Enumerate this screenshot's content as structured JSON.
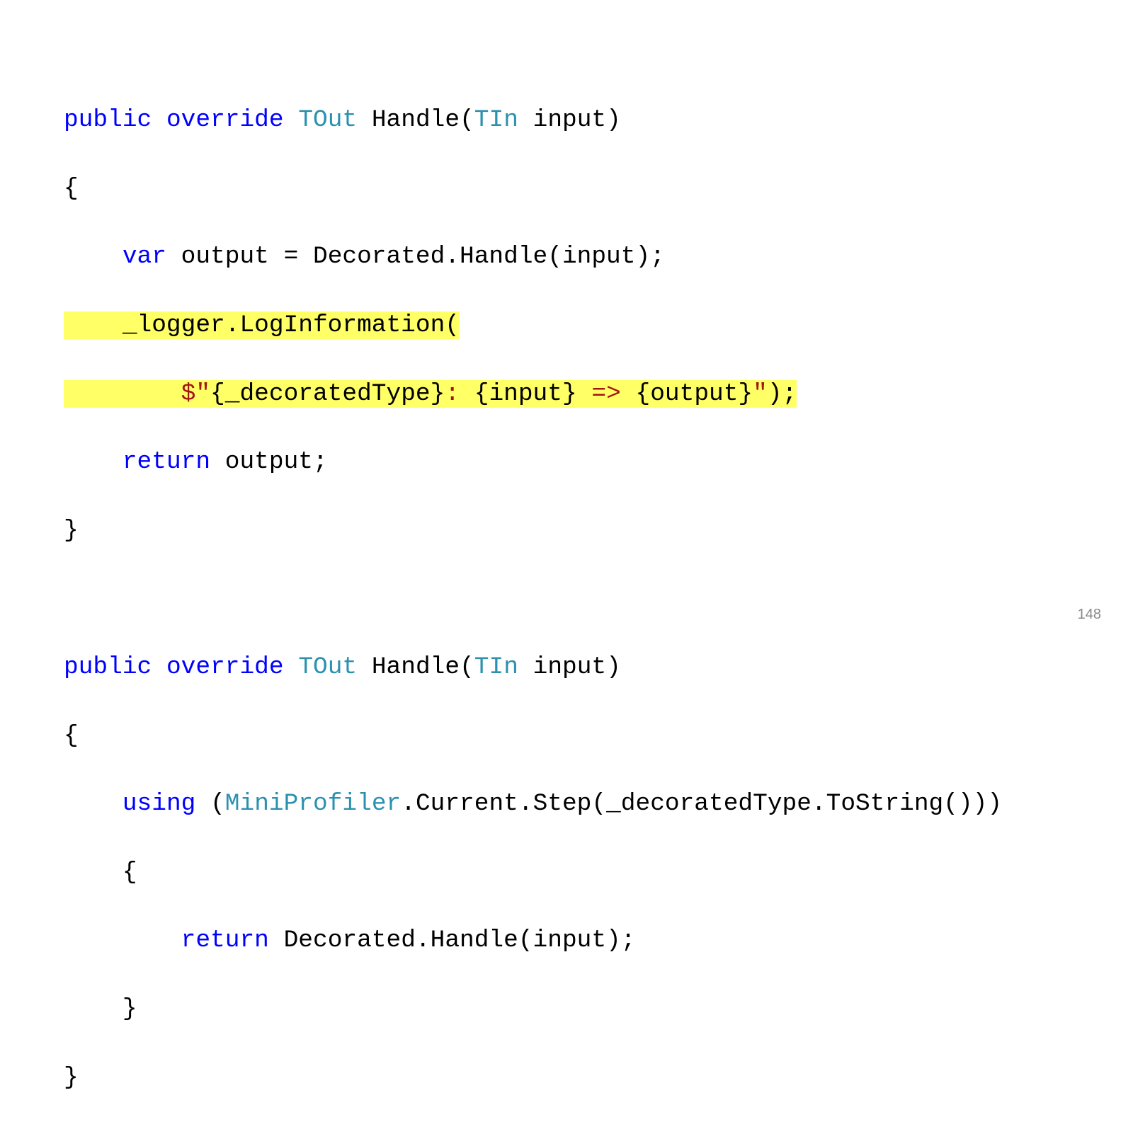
{
  "page_number": "148",
  "code": {
    "block1": {
      "l1": {
        "t1": "public",
        "t2": " ",
        "t3": "override",
        "t4": " ",
        "t5": "TOut",
        "t6": " Handle(",
        "t7": "TIn",
        "t8": " input)"
      },
      "l2": "{",
      "l3": {
        "t1": "    ",
        "t2": "var",
        "t3": " output = Decorated.Handle(input);"
      },
      "l4": {
        "t1": "    _logger.LogInformation("
      },
      "l5": {
        "t1": "        $\"",
        "t2": "{_decoratedType}",
        "t3": ": ",
        "t4": "{input}",
        "t5": " => ",
        "t6": "{output}",
        "t7": "\"",
        "t8": ");"
      },
      "l6": {
        "t1": "    ",
        "t2": "return",
        "t3": " output;"
      },
      "l7": "}"
    },
    "block2": {
      "l1": {
        "t1": "public",
        "t2": " ",
        "t3": "override",
        "t4": " ",
        "t5": "TOut",
        "t6": " Handle(",
        "t7": "TIn",
        "t8": " input)"
      },
      "l2": "{",
      "l3": {
        "t1": "    ",
        "t2": "using",
        "t3": " (",
        "t4": "MiniProfiler",
        "t5": ".Current.Step(_decoratedType.ToString()))"
      },
      "l4": "    {",
      "l5": {
        "t1": "        ",
        "t2": "return",
        "t3": " Decorated.Handle(input);"
      },
      "l6": "    }",
      "l7": "}"
    }
  }
}
